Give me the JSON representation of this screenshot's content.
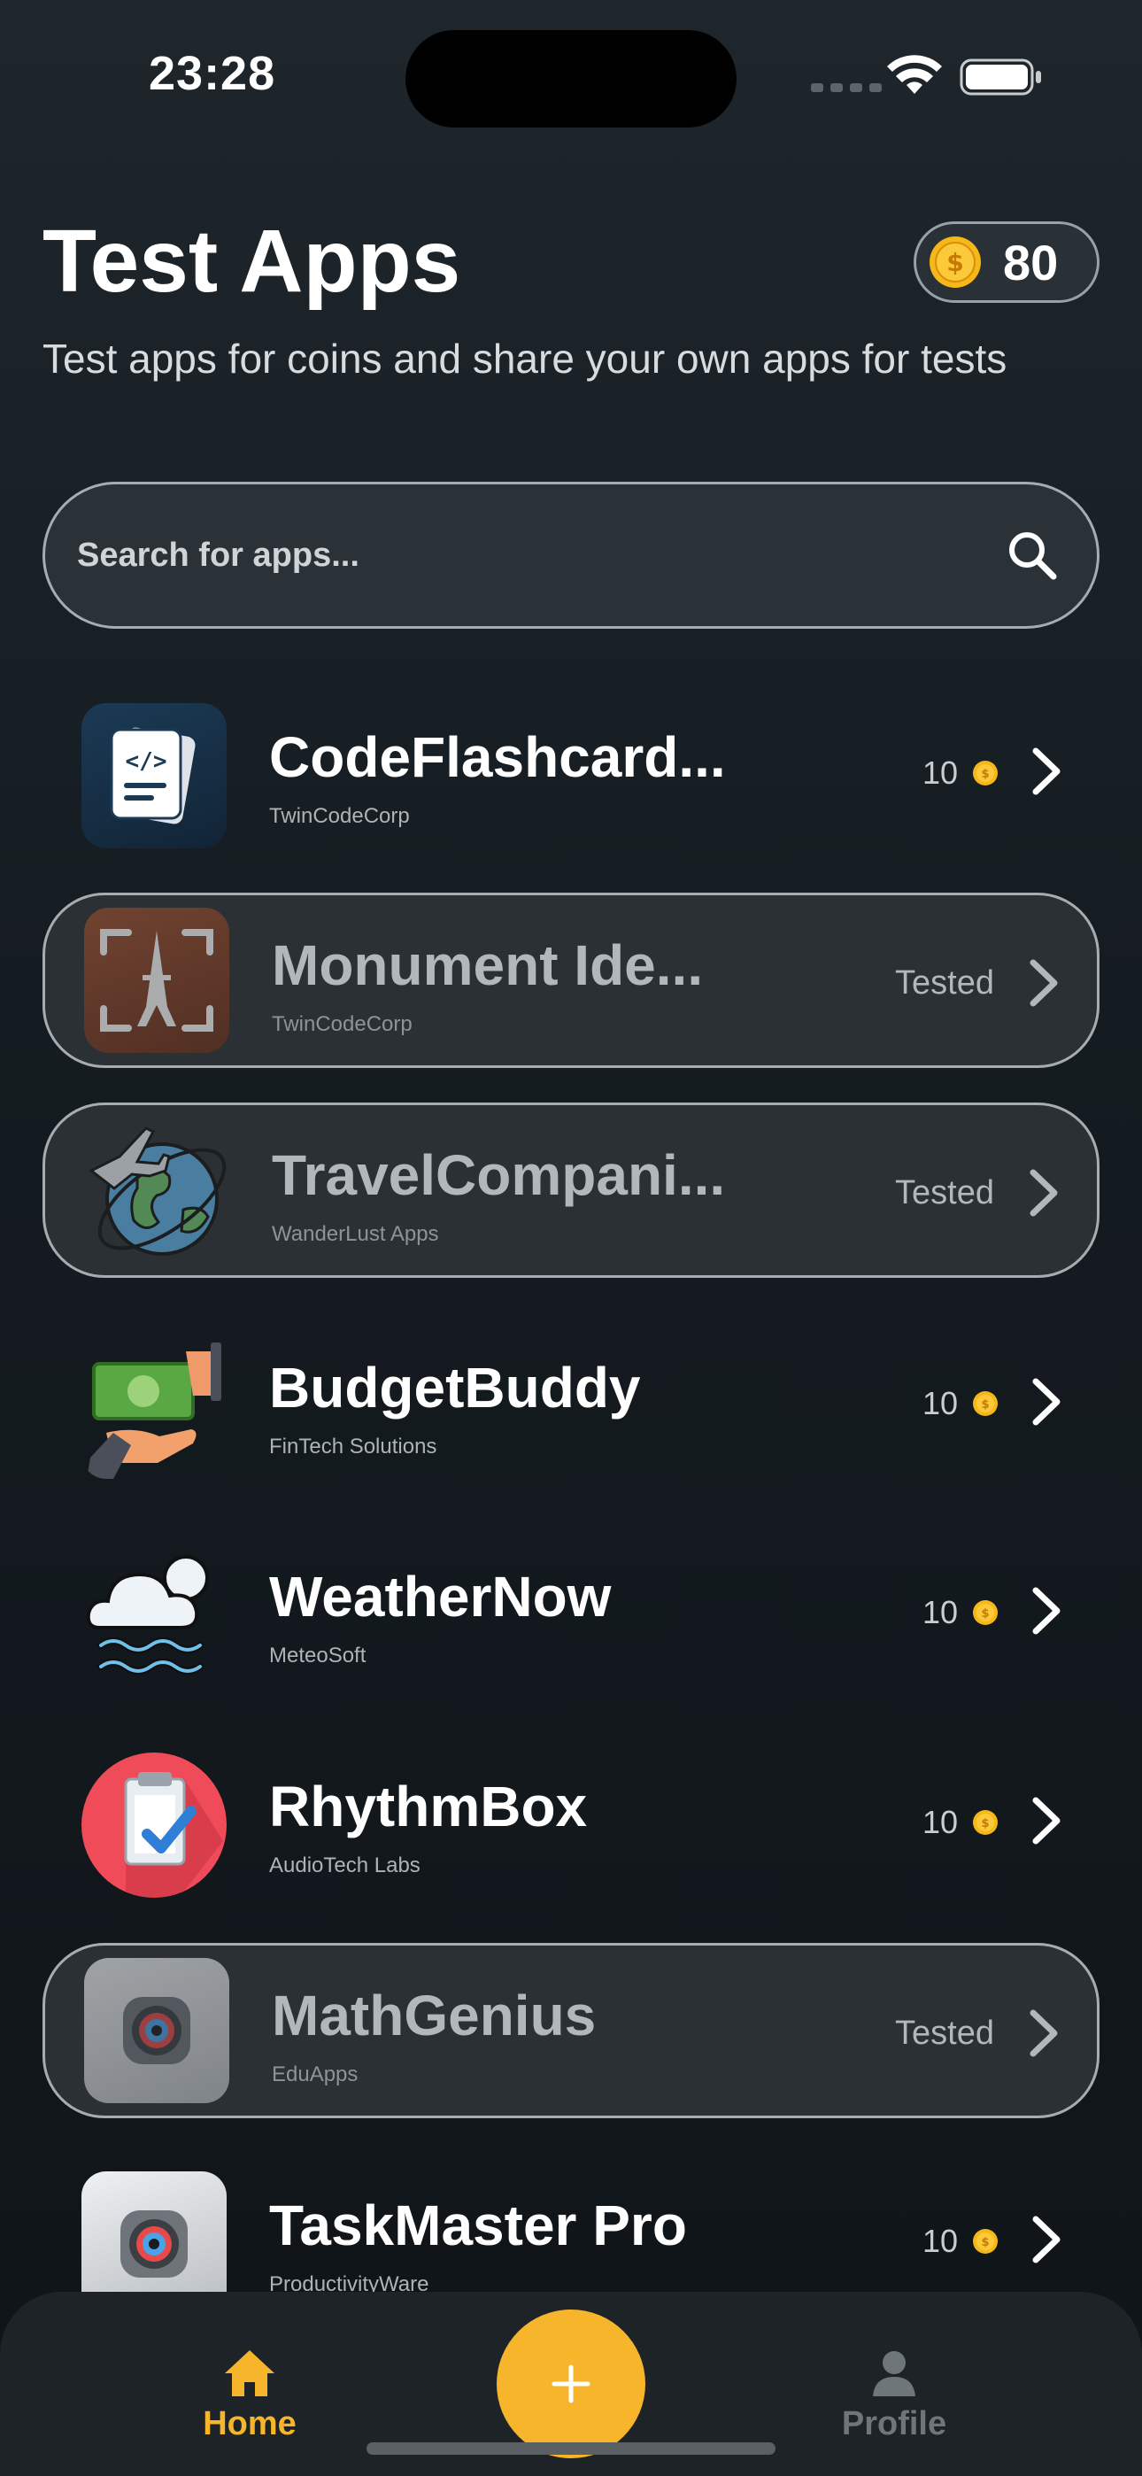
{
  "status_bar": {
    "time": "23:28"
  },
  "header": {
    "title": "Test Apps",
    "subtitle": "Test apps for coins and share your own apps for tests",
    "coins": "80"
  },
  "search": {
    "placeholder": "Search for apps..."
  },
  "apps": [
    {
      "name": "CodeFlashcard...",
      "developer": "TwinCodeCorp",
      "status": "reward",
      "reward": "10",
      "icon": "flashcards-code-icon"
    },
    {
      "name": "Monument Ide...",
      "developer": "TwinCodeCorp",
      "status": "tested",
      "tested_label": "Tested",
      "icon": "eiffel-tower-scan-icon"
    },
    {
      "name": "TravelCompani...",
      "developer": "WanderLust Apps",
      "status": "tested",
      "tested_label": "Tested",
      "icon": "globe-airplane-icon"
    },
    {
      "name": "BudgetBuddy",
      "developer": "FinTech Solutions",
      "status": "reward",
      "reward": "10",
      "icon": "money-hand-icon"
    },
    {
      "name": "WeatherNow",
      "developer": "MeteoSoft",
      "status": "reward",
      "reward": "10",
      "icon": "cloud-waves-icon"
    },
    {
      "name": "RhythmBox",
      "developer": "AudioTech Labs",
      "status": "reward",
      "reward": "10",
      "icon": "clipboard-check-icon"
    },
    {
      "name": "MathGenius",
      "developer": "EduApps",
      "status": "tested",
      "tested_label": "Tested",
      "icon": "camera-lens-icon"
    },
    {
      "name": "TaskMaster Pro",
      "developer": "ProductivityWare",
      "status": "reward",
      "reward": "10",
      "icon": "camera-lens-icon"
    }
  ],
  "nav": {
    "home_label": "Home",
    "profile_label": "Profile"
  },
  "colors": {
    "accent": "#f7b52c",
    "background": "#151c21",
    "coin": "#f5b818"
  }
}
